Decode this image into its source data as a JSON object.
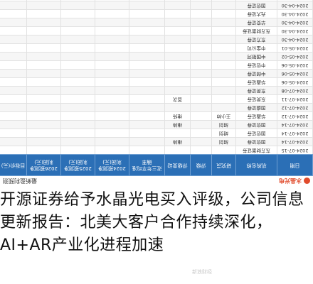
{
  "header": {
    "brand": "水晶光电",
    "subtitle": "最新盈利预测"
  },
  "table": {
    "columns": [
      "日期",
      "机构名称",
      "研究员",
      "评级",
      "评级变动",
      "近三年平均准确率",
      "2024预测净利润(元)",
      "2025预测净利润(元)",
      "2026预测净利润(元)",
      "目标价(元)"
    ],
    "rows": [
      [
        "2024-07-15",
        "东方财富证券",
        "",
        "",
        "",
        "",
        "",
        "",
        "",
        ""
      ],
      [
        "2024-07-14",
        "国信证券",
        "胡剑",
        "",
        "维持",
        "",
        "",
        "",
        "",
        ""
      ],
      [
        "2024-07-14",
        "国信证券",
        "胡剑",
        "",
        "",
        "",
        "",
        "",
        "",
        ""
      ],
      [
        "2024-07-14",
        "国信证券",
        "胡剑",
        "",
        "维持",
        "",
        "",
        "",
        "",
        ""
      ],
      [
        "2024-07-12",
        "华鑫证券",
        "王小帅",
        "",
        "维持",
        "",
        "",
        "",
        "",
        ""
      ],
      [
        "2024-07-12",
        "国盛证券",
        "",
        "",
        "",
        "",
        "",
        "",
        "",
        ""
      ],
      [
        "2024-07-11",
        "东吴证券",
        "",
        "",
        "首次",
        "",
        "",
        "",
        "",
        ""
      ],
      [
        "2024-07-08",
        "东吴证券",
        "",
        "",
        "",
        "",
        "",
        "",
        "",
        ""
      ],
      [
        "2024-05-06",
        "华鑫证券",
        "",
        "",
        "",
        "",
        "",
        "",
        "",
        ""
      ],
      [
        "2024-05-06",
        "中邮证券",
        "",
        "",
        "",
        "",
        "",
        "",
        "",
        ""
      ],
      [
        "2024-05-06",
        "中信证券",
        "",
        "",
        "",
        "",
        "",
        "",
        "",
        ""
      ],
      [
        "2024-05-02",
        "中国银河",
        "",
        "",
        "",
        "",
        "",
        "",
        "",
        ""
      ],
      [
        "2024-05-01",
        "中金公司",
        "",
        "",
        "",
        "",
        "",
        "",
        "",
        ""
      ],
      [
        "2024-04-30",
        "东方证券",
        "",
        "",
        "",
        "",
        "",
        "",
        "",
        ""
      ],
      [
        "2024-04-30",
        "东方财富证券",
        "",
        "",
        "",
        "",
        "",
        "",
        "",
        ""
      ],
      [
        "2024-04-30",
        "华安证券",
        "",
        "",
        "",
        "",
        "",
        "",
        "",
        ""
      ],
      [
        "2024-04-30",
        "光大证券",
        "",
        "",
        "",
        "",
        "",
        "",
        "",
        ""
      ],
      [
        "2024-04-30",
        "国信证券",
        "",
        "",
        "",
        "",
        "",
        "",
        "",
        ""
      ],
      [
        "2024-04-30",
        "信达证券",
        "",
        "",
        "",
        "",
        "",
        "",
        "",
        ""
      ],
      [
        "2024-04-14",
        "中泰证券",
        "",
        "",
        "",
        "",
        "",
        "",
        "",
        ""
      ]
    ]
  },
  "headline": "开源证券给予水晶光电买入评级，公司信息更新报告：北美大客户合作持续深化，AI+AR产业化进程加速",
  "watermark": "新浪财经"
}
